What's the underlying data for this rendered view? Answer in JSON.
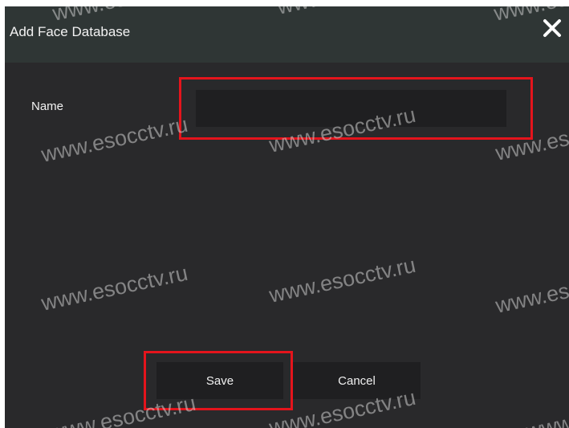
{
  "dialog": {
    "title": "Add Face Database",
    "close_icon": "close-icon",
    "close_glyph": "✕"
  },
  "form": {
    "name_label": "Name",
    "name_value": ""
  },
  "buttons": {
    "save_label": "Save",
    "cancel_label": "Cancel"
  },
  "watermark": {
    "text": "www.esocctv.ru"
  },
  "colors": {
    "dialog_background": "#29292b",
    "title_bar_background": "#2f3635",
    "field_background": "#1f1f21",
    "highlight_red": "#e4141c",
    "text": "#f2f2f2"
  }
}
